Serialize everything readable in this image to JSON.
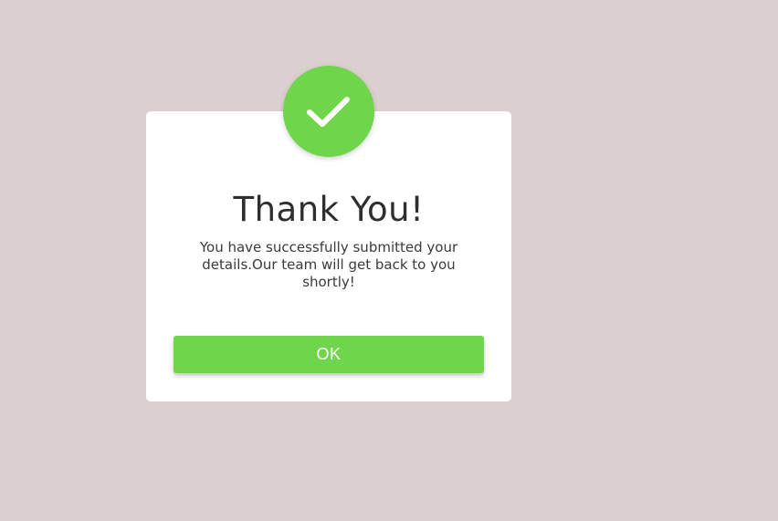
{
  "dialog": {
    "title": "Thank You!",
    "message": "You have successfully submitted your details.Our team will get back to you shortly!",
    "ok_label": "OK",
    "icon": "checkmark-icon"
  },
  "colors": {
    "background": "#dbcfd0",
    "accent": "#6fd64b",
    "card": "#ffffff",
    "title_text": "#2e2e2e"
  }
}
